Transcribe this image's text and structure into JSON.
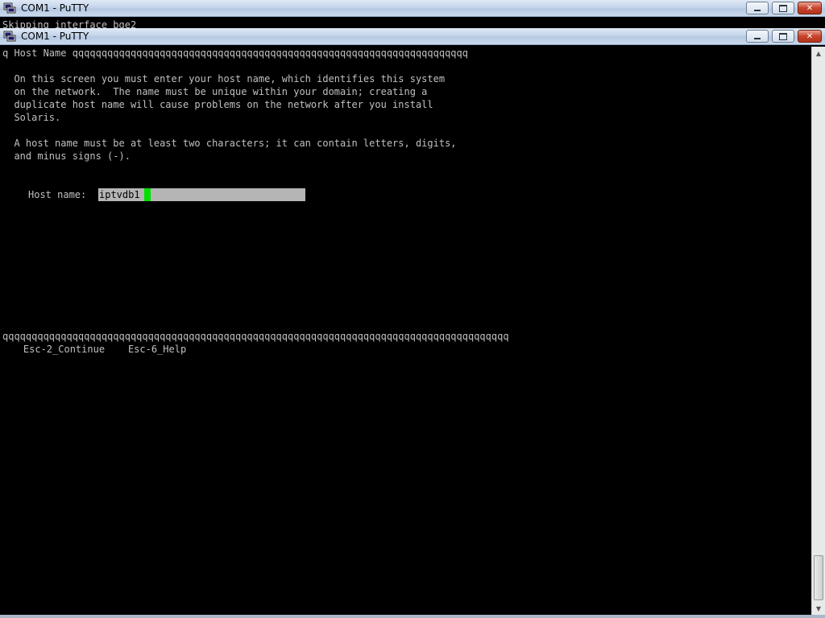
{
  "back_window": {
    "title": "COM1 - PuTTY",
    "terminal_line": "Skipping interface bge2"
  },
  "front_window": {
    "title": "COM1 - PuTTY"
  },
  "icons": {
    "app": "putty-icon",
    "minimize": "minimize-icon",
    "maximize": "maximize-icon",
    "close": "close-icon"
  },
  "terminal": {
    "header_line": "q Host Name qqqqqqqqqqqqqqqqqqqqqqqqqqqqqqqqqqqqqqqqqqqqqqqqqqqqqqqqqqqqqqqqqqqq",
    "paragraph1": [
      "  On this screen you must enter your host name, which identifies this system",
      "  on the network.  The name must be unique within your domain; creating a",
      "  duplicate host name will cause problems on the network after you install",
      "  Solaris."
    ],
    "paragraph2": [
      "  A host name must be at least two characters; it can contain letters, digits,",
      "  and minus signs (-)."
    ],
    "hostname_label": "Host name:",
    "hostname_value": "iptvdb1",
    "footer_line": "qqqqqqqqqqqqqqqqqqqqqqqqqqqqqqqqqqqqqqqqqqqqqqqqqqqqqqqqqqqqqqqqqqqqqqqqqqqqqqqqqqqqqqq",
    "footer_keys": "    Esc-2_Continue    Esc-6_Help"
  },
  "colors": {
    "terminal_bg": "#000000",
    "terminal_fg": "#c0c0c0",
    "cursor": "#00e000",
    "input_bg": "#b5b5b5"
  }
}
